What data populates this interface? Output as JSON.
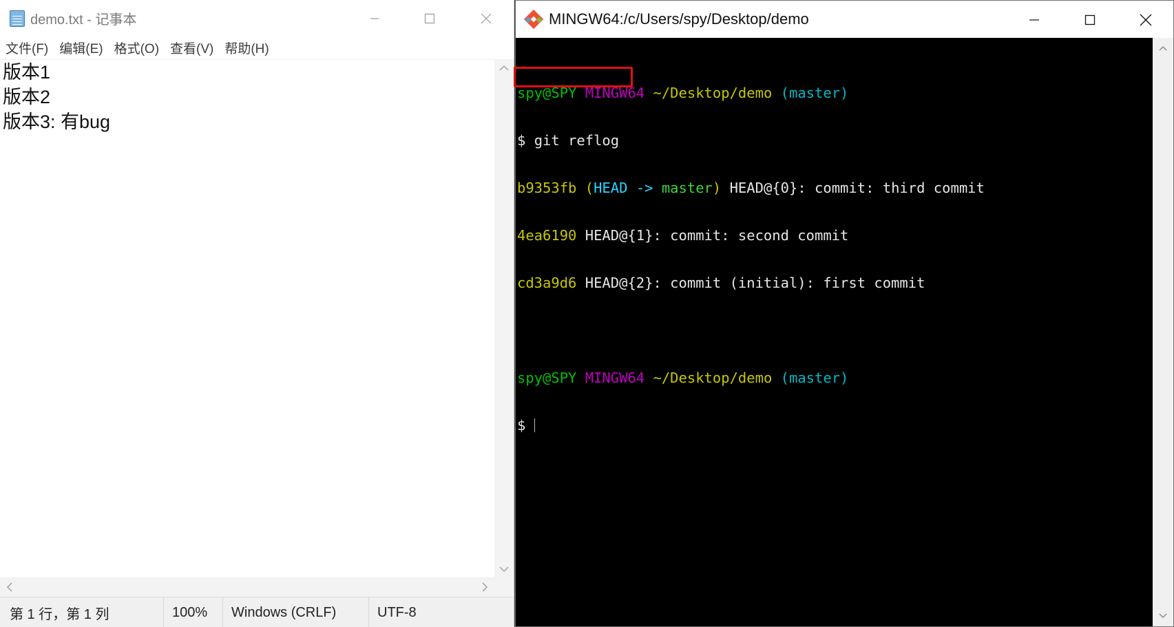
{
  "notepad": {
    "title": "demo.txt - 记事本",
    "menu": [
      "文件(F)",
      "编辑(E)",
      "格式(O)",
      "查看(V)",
      "帮助(H)"
    ],
    "lines": [
      "版本1",
      "版本2",
      "版本3: 有bug"
    ],
    "status": {
      "position": "第 1 行，第 1 列",
      "zoom": "100%",
      "line_ending": "Windows (CRLF)",
      "encoding": "UTF-8"
    }
  },
  "gitbash": {
    "title": "MINGW64:/c/Users/spy/Desktop/demo",
    "prompt": {
      "user": "spy@SPY",
      "env": "MINGW64",
      "path": "~/Desktop/demo",
      "branch": "(master)",
      "symbol": "$"
    },
    "command": "git reflog",
    "reflog": [
      {
        "hash": "b9353fb",
        "head_open": "(",
        "head": "HEAD",
        "arrow": "->",
        "branch": "master",
        "head_close": ")",
        "rest": " HEAD@{0}: commit: third commit"
      },
      {
        "hash": "4ea6190",
        "rest": " HEAD@{1}: commit: second commit"
      },
      {
        "hash": "cd3a9d6",
        "rest": " HEAD@{2}: commit (initial): first commit"
      }
    ]
  },
  "colors": {
    "highlight_box": "#e01010",
    "terminal_bg": "#000000",
    "prompt_user": "#00c000",
    "prompt_env": "#c000c0",
    "prompt_path": "#c7c700",
    "prompt_branch": "#00b9c4"
  },
  "icons": {
    "notepad_app": "notepad-icon",
    "gitbash_app": "git-diamond-icon"
  }
}
